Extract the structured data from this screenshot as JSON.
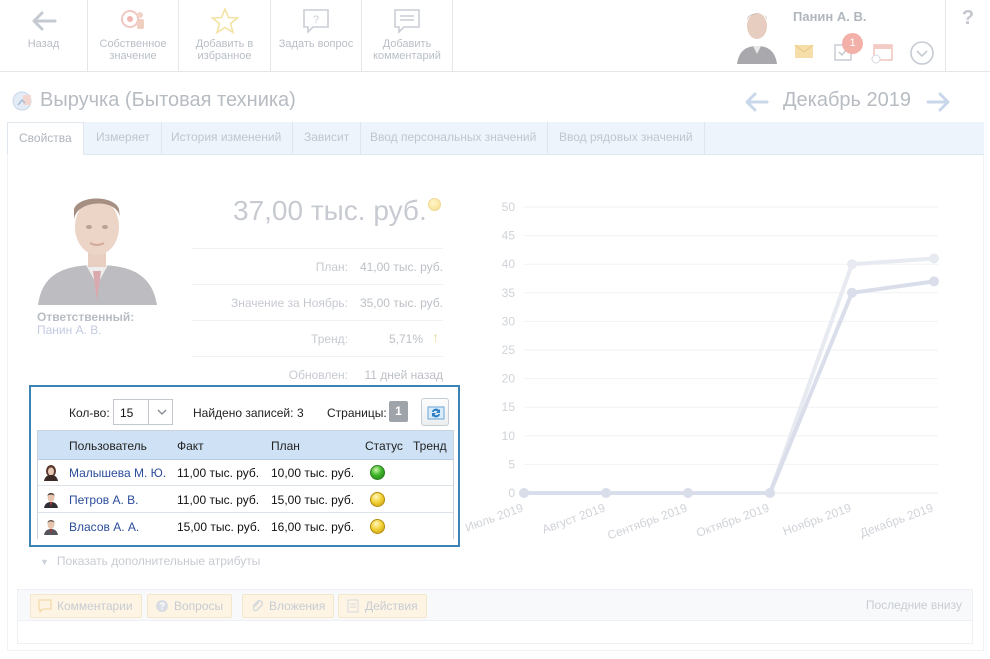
{
  "toolbar": {
    "back_label": "Назад",
    "own_value_label": "Собственное значение",
    "add_fav_label": "Добавить в избранное",
    "ask_label": "Задать вопрос",
    "add_comment_label": "Добавить комментарий",
    "user_name": "Панин А. В.",
    "notification_count": "1",
    "help_label": "?"
  },
  "header": {
    "title": "Выручка (Бытовая техника)",
    "period": "Декабрь 2019"
  },
  "tabs": [
    {
      "label": "Свойства"
    },
    {
      "label": "Измеряет"
    },
    {
      "label": "История изменений"
    },
    {
      "label": "Зависит"
    },
    {
      "label": "Ввод персональных значений"
    },
    {
      "label": "Ввод рядовых значений"
    }
  ],
  "responsible": {
    "title": "Ответственный:",
    "name": "Панин А. В."
  },
  "value": {
    "main": "37,00 тыс. руб.",
    "plan_label": "План:",
    "plan_value": "41,00 тыс. руб.",
    "prev_label": "Значение за Ноябрь:",
    "prev_value": "35,00 тыс. руб.",
    "trend_label": "Тренд:",
    "trend_value": "5,71%",
    "updated_label": "Обновлен:",
    "updated_value": "11 дней назад"
  },
  "grid": {
    "count_label": "Кол-во:",
    "count_value": "15",
    "found_label": "Найдено записей:",
    "found_value": "3",
    "pages_label": "Страницы:",
    "page_current": "1",
    "columns": [
      "Пользователь",
      "Факт",
      "План",
      "Статус",
      "Тренд"
    ],
    "rows": [
      {
        "user": "Малышева М. Ю.",
        "fact": "11,00 тыс. руб.",
        "plan": "10,00 тыс. руб.",
        "status": "green",
        "gender": "f"
      },
      {
        "user": "Петров А. В.",
        "fact": "11,00 тыс. руб.",
        "plan": "15,00 тыс. руб.",
        "status": "yellow",
        "gender": "m"
      },
      {
        "user": "Власов А. А.",
        "fact": "15,00 тыс. руб.",
        "plan": "16,00 тыс. руб.",
        "status": "yellow",
        "gender": "m"
      }
    ]
  },
  "more_attrs_label": "Показать дополнительные атрибуты",
  "discussion": {
    "comments_label": "Комментарии",
    "questions_label": "Вопросы",
    "attachments_label": "Вложения",
    "actions_label": "Действия",
    "order_note": "Последние внизу"
  },
  "chart_data": {
    "type": "line",
    "categories": [
      "Июль 2019",
      "Август 2019",
      "Сентябрь 2019",
      "Октябрь 2019",
      "Ноябрь 2019",
      "Декабрь 2019"
    ],
    "series": [
      {
        "values": [
          0,
          0,
          0,
          0,
          40,
          41
        ]
      },
      {
        "values": [
          0,
          0,
          0,
          0,
          35,
          37
        ]
      }
    ],
    "yticks": [
      0,
      5,
      10,
      15,
      20,
      25,
      30,
      35,
      40,
      45,
      50
    ],
    "ylim": [
      0,
      50
    ],
    "grid": true
  },
  "colors": {
    "accent_border": "#3d84b5",
    "table_header": "#cfe2f5",
    "link": "#2b4c9a",
    "status_green": "#3fb52a",
    "status_yellow": "#f3d23a"
  }
}
